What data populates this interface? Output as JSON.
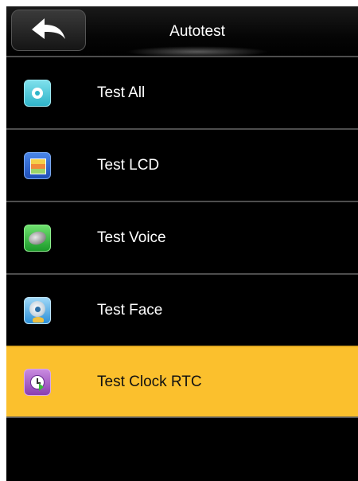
{
  "header": {
    "title": "Autotest",
    "back_icon": "back-arrow-icon"
  },
  "menu": {
    "items": [
      {
        "label": "Test All",
        "icon": "test-all-icon",
        "selected": false
      },
      {
        "label": "Test LCD",
        "icon": "lcd-icon",
        "selected": false
      },
      {
        "label": "Test Voice",
        "icon": "speaker-icon",
        "selected": false
      },
      {
        "label": "Test Face",
        "icon": "camera-icon",
        "selected": false
      },
      {
        "label": "Test Clock RTC",
        "icon": "clock-icon",
        "selected": true
      }
    ]
  },
  "colors": {
    "background": "#000000",
    "selected": "#fbc02d",
    "divider": "#4d4d4d",
    "text": "#ffffff"
  }
}
